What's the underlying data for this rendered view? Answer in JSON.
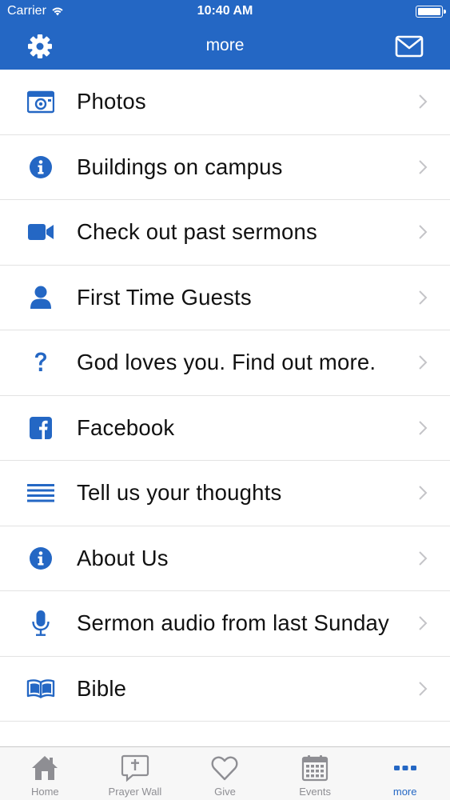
{
  "status_bar": {
    "carrier": "Carrier",
    "time": "10:40 AM"
  },
  "nav": {
    "title": "more"
  },
  "menu": [
    {
      "label": "Photos",
      "icon": "camera-icon"
    },
    {
      "label": "Buildings on campus",
      "icon": "info-icon"
    },
    {
      "label": "Check out past sermons",
      "icon": "video-camera-icon"
    },
    {
      "label": "First Time Guests",
      "icon": "person-icon"
    },
    {
      "label": "God loves you. Find out more.",
      "icon": "question-icon"
    },
    {
      "label": "Facebook",
      "icon": "facebook-icon"
    },
    {
      "label": "Tell us your thoughts",
      "icon": "list-lines-icon"
    },
    {
      "label": "About Us",
      "icon": "info-icon"
    },
    {
      "label": "Sermon audio from last Sunday",
      "icon": "microphone-icon"
    },
    {
      "label": "Bible",
      "icon": "book-icon"
    }
  ],
  "tabs": [
    {
      "label": "Home",
      "icon": "home-icon"
    },
    {
      "label": "Prayer Wall",
      "icon": "prayer-bubble-icon"
    },
    {
      "label": "Give",
      "icon": "heart-icon"
    },
    {
      "label": "Events",
      "icon": "calendar-icon"
    },
    {
      "label": "more",
      "icon": "more-dots-icon",
      "active": true
    }
  ],
  "colors": {
    "brand": "#2467c4",
    "tab_inactive": "#8e8e93",
    "chevron": "#c4c4c8"
  }
}
